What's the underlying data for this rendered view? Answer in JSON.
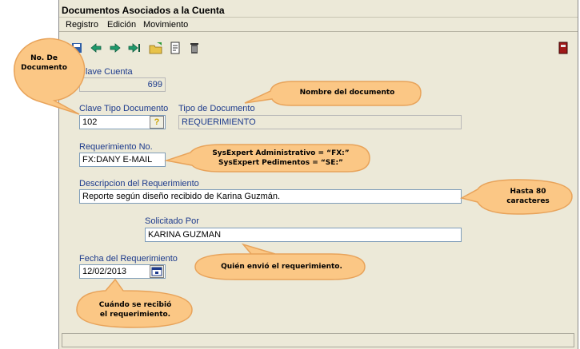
{
  "window": {
    "title": "Documentos Asociados a la Cuenta"
  },
  "menu": [
    "Registro",
    "Edición",
    "Movimiento"
  ],
  "toolbar": {
    "icons": [
      "save-icon",
      "arrow-left-icon",
      "arrow-right-icon",
      "arrow-last-icon",
      "open-folder-icon",
      "document-edit-icon",
      "trash-icon",
      "exit-icon"
    ]
  },
  "form": {
    "clave_cuenta": {
      "label": "Clave Cuenta",
      "value": "699"
    },
    "clave_tipo_doc": {
      "label": "Clave Tipo Documento",
      "value": "102",
      "lookup": "?"
    },
    "tipo_doc": {
      "label": "Tipo de Documento",
      "value": "REQUERIMIENTO"
    },
    "requerimiento_no": {
      "label": "Requerimiento No.",
      "value": "FX:DANY E-MAIL"
    },
    "descripcion": {
      "label": "Descripcion del Requerimiento",
      "value": "Reporte según diseño recibido de Karina Guzmán."
    },
    "solicitado": {
      "label": "Solicitado Por",
      "value": "KARINA GUZMAN"
    },
    "fecha": {
      "label": "Fecha del Requerimiento",
      "value": "12/02/2013"
    }
  },
  "callouts": {
    "no_doc": [
      "No. De",
      "Documento"
    ],
    "nombre": "Nombre del documento",
    "sysexpert": [
      "SysExpert Administrativo = “FX:”",
      "SysExpert Pedimentos = “SE:”"
    ],
    "hasta": [
      "Hasta 80",
      "caracteres"
    ],
    "quien": "Quién envió el requerimiento.",
    "cuando": [
      "Cuándo se recibió",
      "el requerimiento."
    ]
  },
  "colors": {
    "callout_fill": "#fbc785",
    "callout_stroke": "#e8a35a",
    "label": "#1c3a8c"
  }
}
